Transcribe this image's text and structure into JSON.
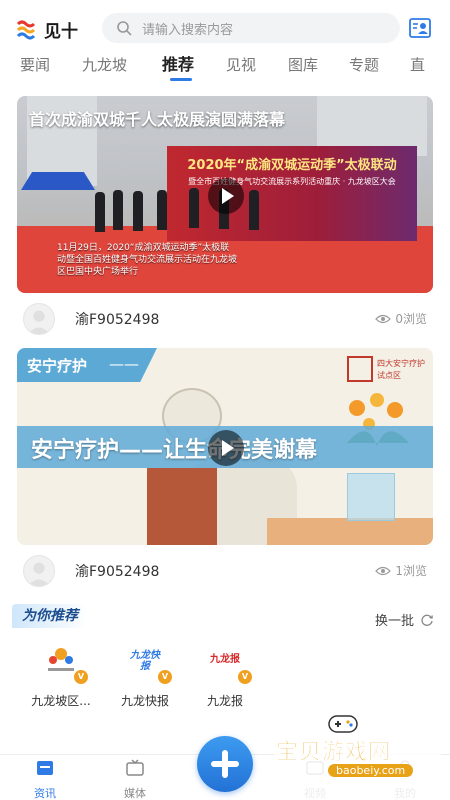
{
  "app": {
    "logo_text": "见十"
  },
  "search": {
    "placeholder": "请输入搜索内容"
  },
  "tabs": [
    {
      "label": "要闻"
    },
    {
      "label": "九龙坡"
    },
    {
      "label": "推荐"
    },
    {
      "label": "见视"
    },
    {
      "label": "图库"
    },
    {
      "label": "专题"
    },
    {
      "label": "直"
    }
  ],
  "active_tab": "推荐",
  "feed": [
    {
      "headline": "首次成渝双城千人太极展演圆满落幕",
      "stage_title": "2020年“成渝双城运动季”太极联动",
      "stage_subtitle": "暨全市百姓健身气功交流展示系列活动重庆 · 九龙坡区大会",
      "caption": "11月29日，2020“成渝双城运动季”太极联动暨全国百姓健身气功交流展示活动在九龙坡区巴国中央广场举行",
      "author": "渝F9052498",
      "views": "0浏览"
    },
    {
      "headline": "安宁疗护——让生命完美谢幕",
      "tag": "安宁疗护",
      "tag_dash": "——",
      "brand": "四大安宁疗护试点区",
      "author": "渝F9052498",
      "views": "1浏览"
    }
  ],
  "recommend": {
    "title": "为你推荐",
    "refresh_label": "换一批",
    "items": [
      {
        "label": "九龙坡区...",
        "badge": "V"
      },
      {
        "label": "九龙快报",
        "badge": "V",
        "logo_text": "九龙快报"
      },
      {
        "label": "九龙报",
        "badge": "V",
        "logo_text": "九龙报"
      }
    ]
  },
  "bottom_nav": [
    {
      "label": "资讯"
    },
    {
      "label": "媒体"
    },
    {
      "label": "视频"
    },
    {
      "label": "我的"
    }
  ],
  "watermark": {
    "text": "宝贝游戏网",
    "url": "baobeiy.com"
  },
  "colors": {
    "accent": "#2f7be5",
    "badge": "#f0a020",
    "watermark": "#e8a217"
  }
}
